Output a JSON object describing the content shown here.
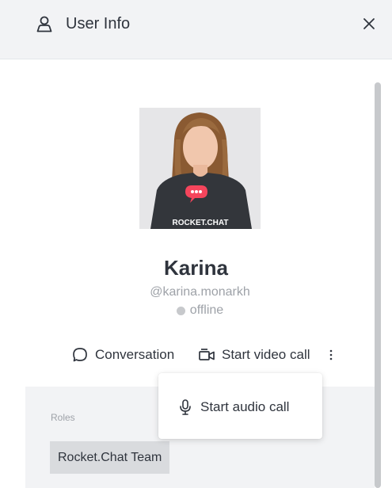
{
  "header": {
    "title": "User Info",
    "title_icon": "user-icon",
    "close_icon": "close-icon"
  },
  "profile": {
    "avatar_text": "ROCKET.CHAT",
    "name": "Karina",
    "username": "@karina.monarkh",
    "status": "offline",
    "status_color": "#c7c9cc"
  },
  "actions": {
    "conversation_label": "Conversation",
    "conversation_icon": "chat-bubble-icon",
    "video_label": "Start video call",
    "video_icon": "video-camera-icon",
    "more_icon": "kebab-icon"
  },
  "menu": {
    "items": [
      {
        "label": "Start audio call",
        "icon": "microphone-icon"
      }
    ]
  },
  "details": {
    "roles_label": "Roles",
    "roles": [
      "Rocket.Chat Team"
    ]
  },
  "colors": {
    "text": "#2f343d",
    "muted": "#9ea2a8",
    "panel": "#f2f3f5",
    "brand_red": "#f5455c"
  }
}
